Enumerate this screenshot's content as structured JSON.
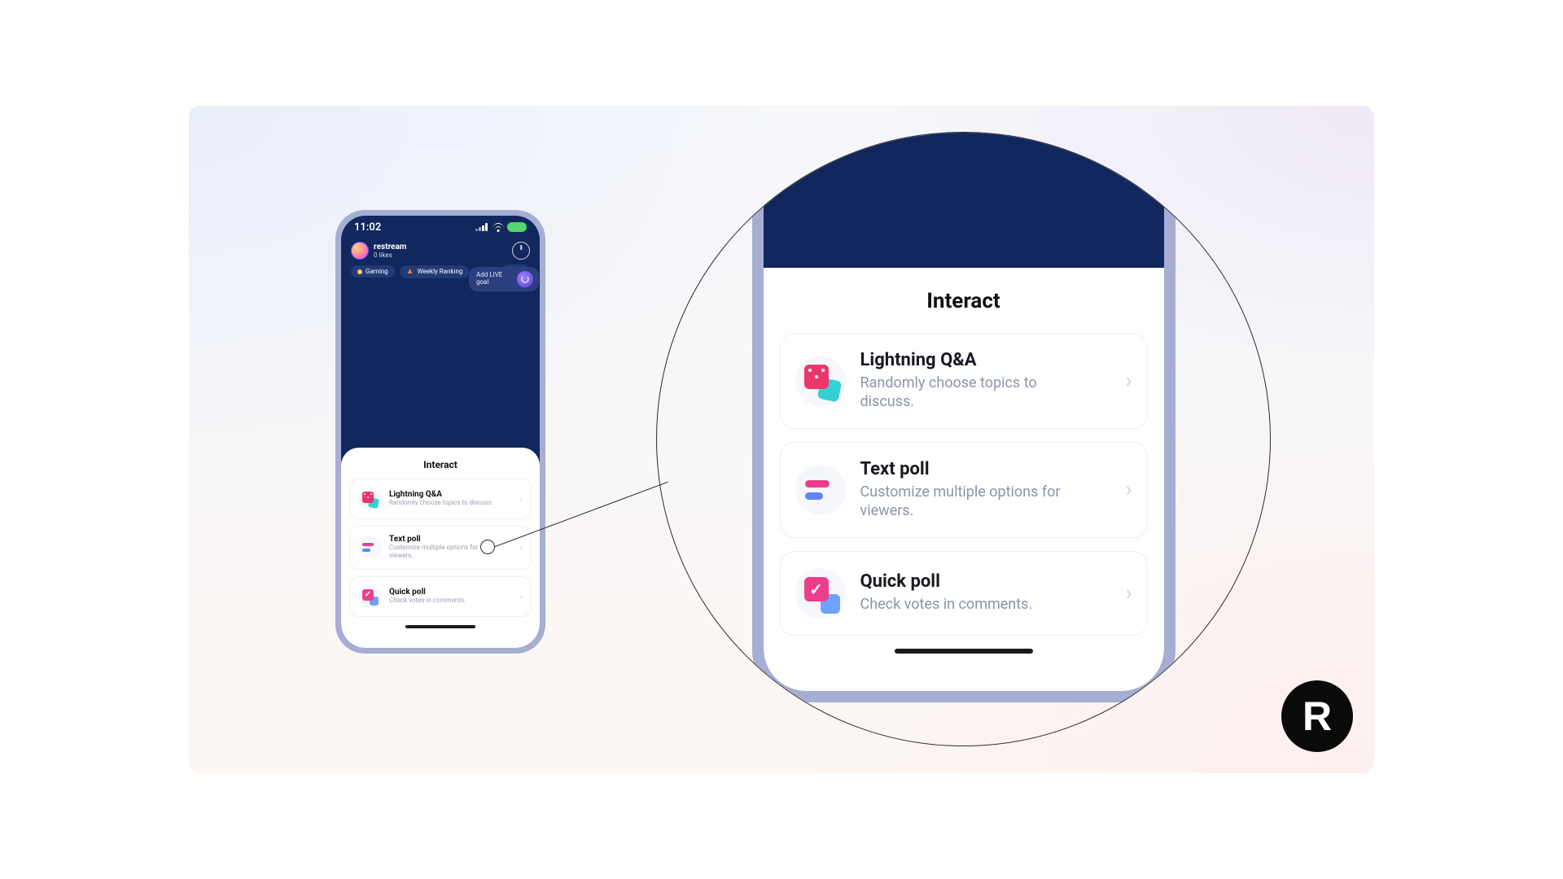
{
  "status": {
    "time": "11:02"
  },
  "profile": {
    "name": "restream",
    "likes": "0 likes"
  },
  "tags": {
    "gaming": "Gaming",
    "ranking": "Weekly Ranking"
  },
  "live_goal": {
    "label": "Add LIVE goal"
  },
  "sheet": {
    "title": "Interact",
    "items": [
      {
        "title": "Lightning Q&A",
        "desc": "Randomly choose topics to discuss."
      },
      {
        "title": "Text poll",
        "desc": "Customize multiple options for viewers."
      },
      {
        "title": "Quick poll",
        "desc": "Check votes in comments."
      }
    ]
  },
  "brand": {
    "letter": "R"
  }
}
